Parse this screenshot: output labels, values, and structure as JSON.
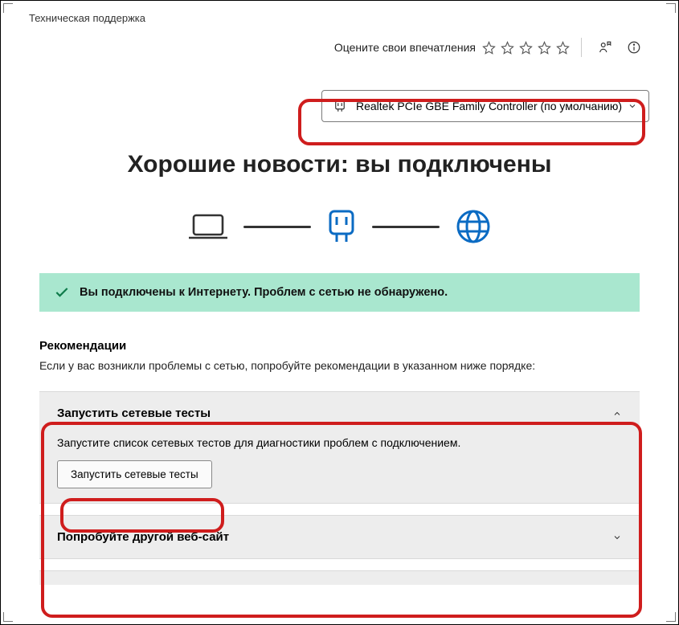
{
  "header": {
    "app_title": "Техническая поддержка",
    "rating_label": "Оцените свои впечатления"
  },
  "device": {
    "label": "Realtek PCIe GBE Family Controller (по умолчанию)"
  },
  "main": {
    "heading": "Хорошие новости: вы подключены"
  },
  "status": {
    "text": "Вы подключены к Интернету. Проблем с сетью не обнаружено."
  },
  "recommendations": {
    "title": "Рекомендации",
    "subtitle": "Если у вас возникли проблемы с сетью, попробуйте рекомендации в указанном ниже порядке:",
    "items": [
      {
        "title": "Запустить сетевые тесты",
        "desc": "Запустите список сетевых тестов для диагностики проблем с подключением.",
        "button": "Запустить сетевые тесты",
        "expanded": true
      },
      {
        "title": "Попробуйте другой веб-сайт",
        "expanded": false
      }
    ]
  }
}
